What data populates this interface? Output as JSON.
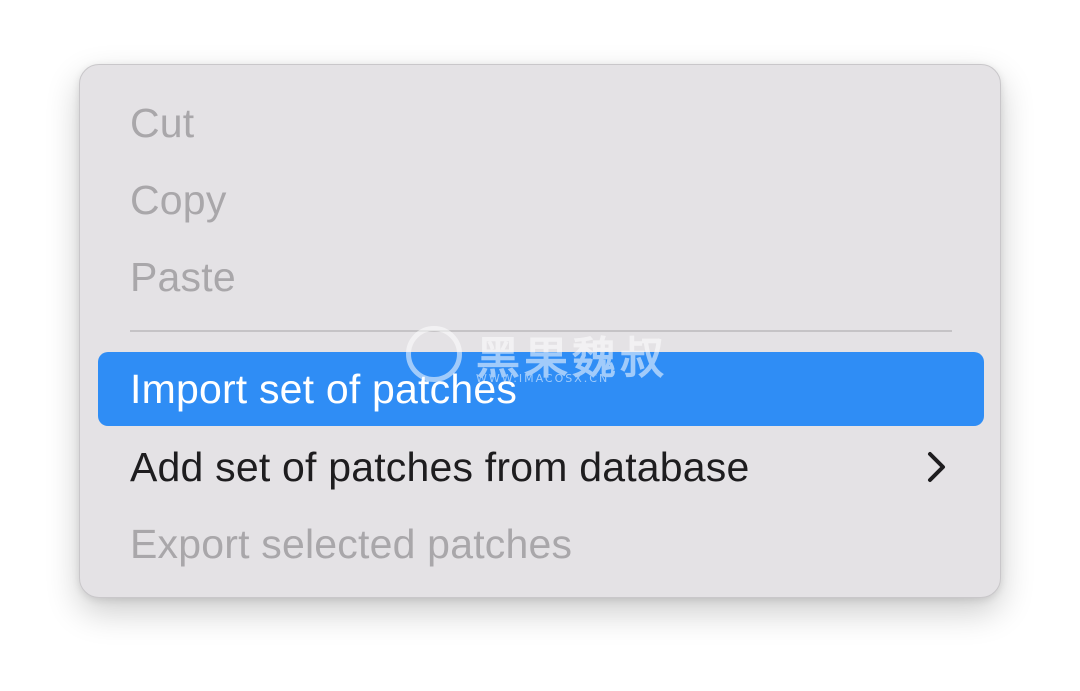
{
  "menu": {
    "cut_label": "Cut",
    "copy_label": "Copy",
    "paste_label": "Paste",
    "import_label": "Import set of patches",
    "add_label": "Add set of patches from database",
    "export_label": "Export selected patches",
    "submenu_icon": "chevron-right-icon"
  },
  "watermark": {
    "title": "黑果魏叔",
    "subtitle": "WWW.IMACOSX.CN"
  },
  "colors": {
    "menu_background": "#e4e2e5",
    "highlight": "#2f8df5",
    "enabled_text": "#1e1d1f",
    "disabled_text": "#a9a7aa",
    "highlighted_text": "#ffffff"
  }
}
